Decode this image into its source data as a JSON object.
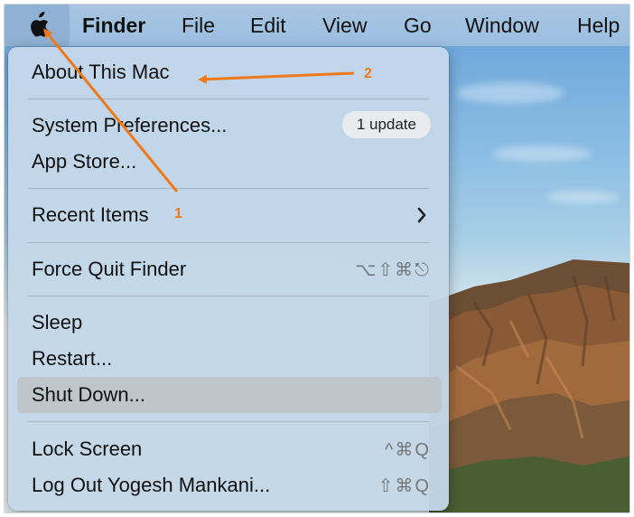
{
  "menubar": {
    "apple_icon": "apple-logo-icon",
    "items": [
      "Finder",
      "File",
      "Edit",
      "View",
      "Go",
      "Window",
      "Help"
    ]
  },
  "apple_menu": {
    "about": "About This Mac",
    "system_preferences": "System Preferences...",
    "update_badge": "1 update",
    "app_store": "App Store...",
    "recent_items": "Recent Items",
    "force_quit": "Force Quit Finder",
    "force_quit_shortcut": "⌥⇧⌘⎋",
    "sleep": "Sleep",
    "restart": "Restart...",
    "shut_down": "Shut Down...",
    "lock_screen": "Lock Screen",
    "lock_screen_shortcut": "^⌘Q",
    "log_out": "Log Out Yogesh Mankani...",
    "log_out_shortcut": "⇧⌘Q"
  },
  "annotations": {
    "step1": "1",
    "step2": "2",
    "arrow_color": "#f07a1a"
  },
  "colors": {
    "highlight": "#c3c8cc",
    "menubar": "#a3c3e2",
    "wallpaper_sky": "#8ebfe4"
  }
}
